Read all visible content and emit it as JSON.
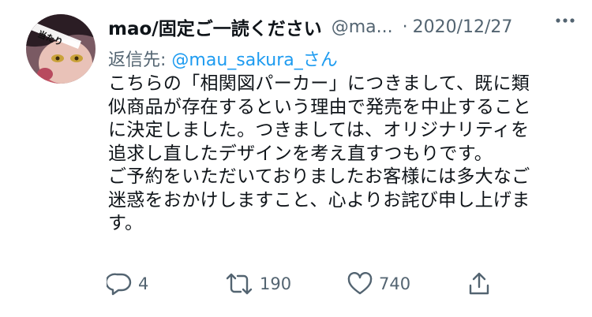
{
  "tweet": {
    "author": {
      "display_name": "mao/固定ご一読ください",
      "handle": "@ma...",
      "avatar_text": "当たり"
    },
    "separator": "·",
    "date": "2020/12/27",
    "reply_to": {
      "prefix": "返信先:",
      "handle": "@mau_sakura_さん"
    },
    "text_lines": [
      "こちらの「相関図パーカー」につきまして、既に類",
      "似商品が存在するという理由で発売を中止すること",
      "に決定しました。つきましては、オリジナリティを",
      "追求し直したデザインを考え直すつもりです。",
      "ご予約をいただいておりましたお客様には多大なご",
      "迷惑をおかけしますこと、心よりお詫び申し上げま",
      "す。"
    ],
    "actions": {
      "reply_count": "4",
      "retweet_count": "190",
      "like_count": "740"
    }
  },
  "colors": {
    "text": "#0f1419",
    "secondary": "#536471",
    "link": "#1d9bf0",
    "background": "#ffffff"
  },
  "icons": [
    "more-icon",
    "reply-icon",
    "retweet-icon",
    "like-icon",
    "share-icon"
  ]
}
